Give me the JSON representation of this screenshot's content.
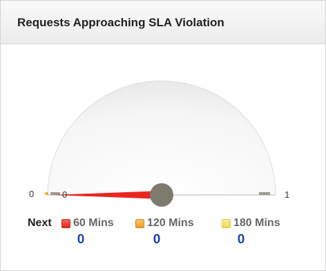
{
  "widget": {
    "title": "Requests Approaching SLA Violation"
  },
  "gauge": {
    "min_label": "0",
    "max_label": "1",
    "needle_label": "0",
    "value": 0,
    "min": 0,
    "max": 1,
    "colors": {
      "needle": "#e8261f",
      "pivot": "#7d7b6e",
      "face": "#f2f2f2"
    }
  },
  "legend": {
    "prefix": "Next",
    "items": [
      {
        "label": "60 Mins",
        "count": "0",
        "color": "#e8413b",
        "icon": "red-square-icon"
      },
      {
        "label": "120 Mins",
        "count": "0",
        "color": "#f5a436",
        "icon": "orange-square-icon"
      },
      {
        "label": "180 Mins",
        "count": "0",
        "color": "#f3e36a",
        "icon": "yellow-square-icon"
      }
    ]
  }
}
